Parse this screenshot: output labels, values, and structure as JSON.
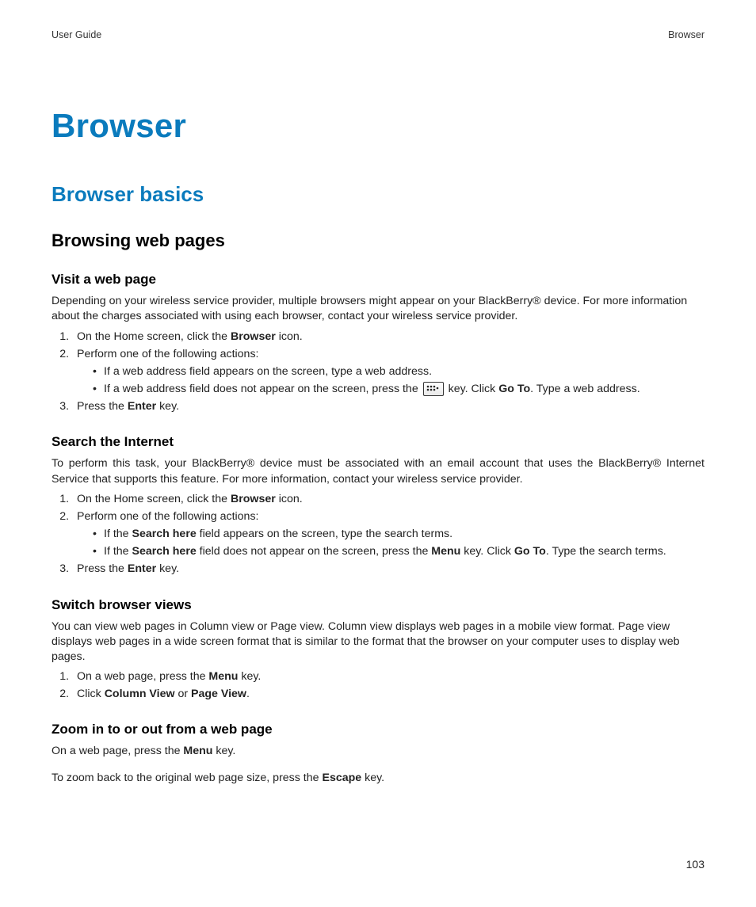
{
  "header": {
    "left": "User Guide",
    "right": "Browser"
  },
  "chapter_title": "Browser",
  "section_title": "Browser basics",
  "subsection_title": "Browsing web pages",
  "topics": {
    "visit": {
      "title": "Visit a web page",
      "intro": "Depending on your wireless service provider, multiple browsers might appear on your BlackBerry® device. For more information about the charges associated with using each browser, contact your wireless service provider.",
      "step1_prefix": "On the Home screen, click the ",
      "step1_bold": "Browser",
      "step1_suffix": " icon.",
      "step2": "Perform one of the following actions:",
      "bullet1": "If a web address field appears on the screen, type a web address.",
      "bullet2_prefix": "If a web address field does not appear on the screen, press the ",
      "bullet2_mid": " key. Click ",
      "bullet2_bold": "Go To",
      "bullet2_suffix": ". Type a web address.",
      "step3_prefix": "Press the ",
      "step3_bold": "Enter",
      "step3_suffix": " key."
    },
    "search": {
      "title": "Search the Internet",
      "intro": "To perform this task, your BlackBerry® device must be associated with an email account that uses the BlackBerry® Internet Service that supports this feature. For more information, contact your wireless service provider.",
      "step1_prefix": "On the Home screen, click the ",
      "step1_bold": "Browser",
      "step1_suffix": " icon.",
      "step2": "Perform one of the following actions:",
      "bullet1_prefix": "If the ",
      "bullet1_bold": "Search here",
      "bullet1_suffix": " field appears on the screen, type the search terms.",
      "bullet2_prefix": "If the ",
      "bullet2_bold1": "Search here",
      "bullet2_mid1": " field does not appear on the screen, press the ",
      "bullet2_bold2": "Menu",
      "bullet2_mid2": " key. Click ",
      "bullet2_bold3": "Go To",
      "bullet2_suffix": ". Type the search terms.",
      "step3_prefix": "Press the ",
      "step3_bold": "Enter",
      "step3_suffix": " key."
    },
    "switch": {
      "title": "Switch browser views",
      "intro": "You can view web pages in Column view or Page view. Column view displays web pages in a mobile view format. Page view displays web pages in a wide screen format that is similar to the format that the browser on your computer uses to display web pages.",
      "step1_prefix": "On a web page, press the ",
      "step1_bold": "Menu",
      "step1_suffix": " key.",
      "step2_prefix": "Click ",
      "step2_bold1": "Column View",
      "step2_mid": " or ",
      "step2_bold2": "Page View",
      "step2_suffix": "."
    },
    "zoom": {
      "title": "Zoom in to or out from a web page",
      "p1_prefix": "On a web page, press the ",
      "p1_bold": "Menu",
      "p1_suffix": " key.",
      "p2_prefix": "To zoom back to the original web page size, press the ",
      "p2_bold": "Escape",
      "p2_suffix": " key."
    }
  },
  "page_number": "103"
}
